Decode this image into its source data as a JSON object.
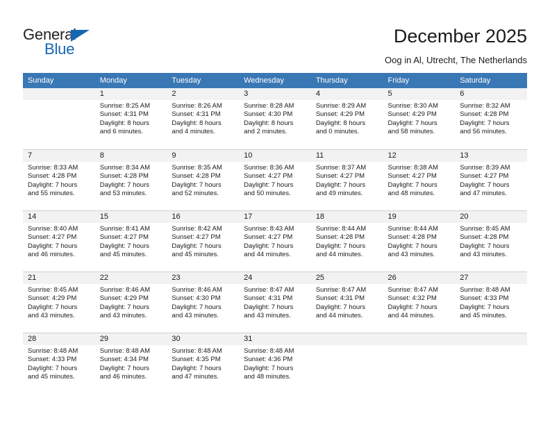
{
  "brand": {
    "name_part1": "General",
    "name_part2": "Blue",
    "accent_color": "#1667b1"
  },
  "header": {
    "title": "December 2025",
    "subtitle": "Oog in Al, Utrecht, The Netherlands",
    "header_bg_color": "#3a78b5",
    "band_color": "#f2f2f2"
  },
  "weekday_headers": [
    "Sunday",
    "Monday",
    "Tuesday",
    "Wednesday",
    "Thursday",
    "Friday",
    "Saturday"
  ],
  "weeks": [
    [
      {
        "day": "",
        "sunrise": "",
        "sunset": "",
        "daylight_line1": "",
        "daylight_line2": ""
      },
      {
        "day": "1",
        "sunrise": "Sunrise: 8:25 AM",
        "sunset": "Sunset: 4:31 PM",
        "daylight_line1": "Daylight: 8 hours",
        "daylight_line2": "and 6 minutes."
      },
      {
        "day": "2",
        "sunrise": "Sunrise: 8:26 AM",
        "sunset": "Sunset: 4:31 PM",
        "daylight_line1": "Daylight: 8 hours",
        "daylight_line2": "and 4 minutes."
      },
      {
        "day": "3",
        "sunrise": "Sunrise: 8:28 AM",
        "sunset": "Sunset: 4:30 PM",
        "daylight_line1": "Daylight: 8 hours",
        "daylight_line2": "and 2 minutes."
      },
      {
        "day": "4",
        "sunrise": "Sunrise: 8:29 AM",
        "sunset": "Sunset: 4:29 PM",
        "daylight_line1": "Daylight: 8 hours",
        "daylight_line2": "and 0 minutes."
      },
      {
        "day": "5",
        "sunrise": "Sunrise: 8:30 AM",
        "sunset": "Sunset: 4:29 PM",
        "daylight_line1": "Daylight: 7 hours",
        "daylight_line2": "and 58 minutes."
      },
      {
        "day": "6",
        "sunrise": "Sunrise: 8:32 AM",
        "sunset": "Sunset: 4:28 PM",
        "daylight_line1": "Daylight: 7 hours",
        "daylight_line2": "and 56 minutes."
      }
    ],
    [
      {
        "day": "7",
        "sunrise": "Sunrise: 8:33 AM",
        "sunset": "Sunset: 4:28 PM",
        "daylight_line1": "Daylight: 7 hours",
        "daylight_line2": "and 55 minutes."
      },
      {
        "day": "8",
        "sunrise": "Sunrise: 8:34 AM",
        "sunset": "Sunset: 4:28 PM",
        "daylight_line1": "Daylight: 7 hours",
        "daylight_line2": "and 53 minutes."
      },
      {
        "day": "9",
        "sunrise": "Sunrise: 8:35 AM",
        "sunset": "Sunset: 4:28 PM",
        "daylight_line1": "Daylight: 7 hours",
        "daylight_line2": "and 52 minutes."
      },
      {
        "day": "10",
        "sunrise": "Sunrise: 8:36 AM",
        "sunset": "Sunset: 4:27 PM",
        "daylight_line1": "Daylight: 7 hours",
        "daylight_line2": "and 50 minutes."
      },
      {
        "day": "11",
        "sunrise": "Sunrise: 8:37 AM",
        "sunset": "Sunset: 4:27 PM",
        "daylight_line1": "Daylight: 7 hours",
        "daylight_line2": "and 49 minutes."
      },
      {
        "day": "12",
        "sunrise": "Sunrise: 8:38 AM",
        "sunset": "Sunset: 4:27 PM",
        "daylight_line1": "Daylight: 7 hours",
        "daylight_line2": "and 48 minutes."
      },
      {
        "day": "13",
        "sunrise": "Sunrise: 8:39 AM",
        "sunset": "Sunset: 4:27 PM",
        "daylight_line1": "Daylight: 7 hours",
        "daylight_line2": "and 47 minutes."
      }
    ],
    [
      {
        "day": "14",
        "sunrise": "Sunrise: 8:40 AM",
        "sunset": "Sunset: 4:27 PM",
        "daylight_line1": "Daylight: 7 hours",
        "daylight_line2": "and 46 minutes."
      },
      {
        "day": "15",
        "sunrise": "Sunrise: 8:41 AM",
        "sunset": "Sunset: 4:27 PM",
        "daylight_line1": "Daylight: 7 hours",
        "daylight_line2": "and 45 minutes."
      },
      {
        "day": "16",
        "sunrise": "Sunrise: 8:42 AM",
        "sunset": "Sunset: 4:27 PM",
        "daylight_line1": "Daylight: 7 hours",
        "daylight_line2": "and 45 minutes."
      },
      {
        "day": "17",
        "sunrise": "Sunrise: 8:43 AM",
        "sunset": "Sunset: 4:27 PM",
        "daylight_line1": "Daylight: 7 hours",
        "daylight_line2": "and 44 minutes."
      },
      {
        "day": "18",
        "sunrise": "Sunrise: 8:44 AM",
        "sunset": "Sunset: 4:28 PM",
        "daylight_line1": "Daylight: 7 hours",
        "daylight_line2": "and 44 minutes."
      },
      {
        "day": "19",
        "sunrise": "Sunrise: 8:44 AM",
        "sunset": "Sunset: 4:28 PM",
        "daylight_line1": "Daylight: 7 hours",
        "daylight_line2": "and 43 minutes."
      },
      {
        "day": "20",
        "sunrise": "Sunrise: 8:45 AM",
        "sunset": "Sunset: 4:28 PM",
        "daylight_line1": "Daylight: 7 hours",
        "daylight_line2": "and 43 minutes."
      }
    ],
    [
      {
        "day": "21",
        "sunrise": "Sunrise: 8:45 AM",
        "sunset": "Sunset: 4:29 PM",
        "daylight_line1": "Daylight: 7 hours",
        "daylight_line2": "and 43 minutes."
      },
      {
        "day": "22",
        "sunrise": "Sunrise: 8:46 AM",
        "sunset": "Sunset: 4:29 PM",
        "daylight_line1": "Daylight: 7 hours",
        "daylight_line2": "and 43 minutes."
      },
      {
        "day": "23",
        "sunrise": "Sunrise: 8:46 AM",
        "sunset": "Sunset: 4:30 PM",
        "daylight_line1": "Daylight: 7 hours",
        "daylight_line2": "and 43 minutes."
      },
      {
        "day": "24",
        "sunrise": "Sunrise: 8:47 AM",
        "sunset": "Sunset: 4:31 PM",
        "daylight_line1": "Daylight: 7 hours",
        "daylight_line2": "and 43 minutes."
      },
      {
        "day": "25",
        "sunrise": "Sunrise: 8:47 AM",
        "sunset": "Sunset: 4:31 PM",
        "daylight_line1": "Daylight: 7 hours",
        "daylight_line2": "and 44 minutes."
      },
      {
        "day": "26",
        "sunrise": "Sunrise: 8:47 AM",
        "sunset": "Sunset: 4:32 PM",
        "daylight_line1": "Daylight: 7 hours",
        "daylight_line2": "and 44 minutes."
      },
      {
        "day": "27",
        "sunrise": "Sunrise: 8:48 AM",
        "sunset": "Sunset: 4:33 PM",
        "daylight_line1": "Daylight: 7 hours",
        "daylight_line2": "and 45 minutes."
      }
    ],
    [
      {
        "day": "28",
        "sunrise": "Sunrise: 8:48 AM",
        "sunset": "Sunset: 4:33 PM",
        "daylight_line1": "Daylight: 7 hours",
        "daylight_line2": "and 45 minutes."
      },
      {
        "day": "29",
        "sunrise": "Sunrise: 8:48 AM",
        "sunset": "Sunset: 4:34 PM",
        "daylight_line1": "Daylight: 7 hours",
        "daylight_line2": "and 46 minutes."
      },
      {
        "day": "30",
        "sunrise": "Sunrise: 8:48 AM",
        "sunset": "Sunset: 4:35 PM",
        "daylight_line1": "Daylight: 7 hours",
        "daylight_line2": "and 47 minutes."
      },
      {
        "day": "31",
        "sunrise": "Sunrise: 8:48 AM",
        "sunset": "Sunset: 4:36 PM",
        "daylight_line1": "Daylight: 7 hours",
        "daylight_line2": "and 48 minutes."
      },
      {
        "day": "",
        "sunrise": "",
        "sunset": "",
        "daylight_line1": "",
        "daylight_line2": ""
      },
      {
        "day": "",
        "sunrise": "",
        "sunset": "",
        "daylight_line1": "",
        "daylight_line2": ""
      },
      {
        "day": "",
        "sunrise": "",
        "sunset": "",
        "daylight_line1": "",
        "daylight_line2": ""
      }
    ]
  ]
}
